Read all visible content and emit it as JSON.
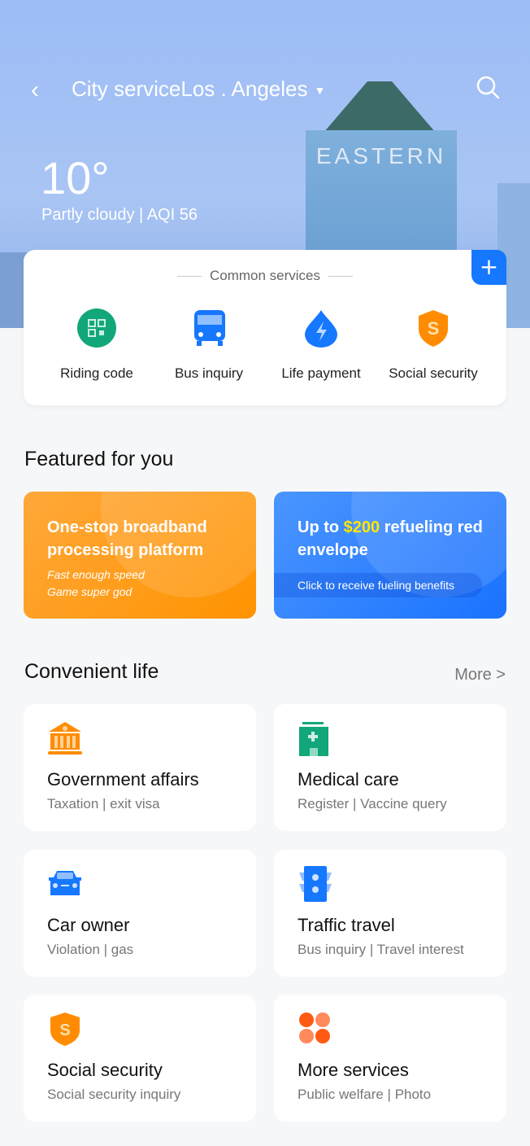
{
  "header": {
    "title": "City serviceLos . Angeles",
    "building_sign": "EASTERN"
  },
  "weather": {
    "temperature": "10°",
    "summary": "Partly cloudy | AQI 56"
  },
  "common_services": {
    "title": "Common services",
    "items": [
      {
        "label": "Riding code",
        "icon": "qr-code-icon",
        "color": "#12a77a"
      },
      {
        "label": "Bus inquiry",
        "icon": "bus-icon",
        "color": "#1677ff"
      },
      {
        "label": "Life payment",
        "icon": "bolt-drop-icon",
        "color": "#1677ff"
      },
      {
        "label": "Social security",
        "icon": "shield-s-icon",
        "color": "#ff8c00"
      }
    ]
  },
  "featured": {
    "title": "Featured for you",
    "banners": [
      {
        "title": "One-stop broadband processing platform",
        "lines": [
          "Fast enough speed",
          "Game super god"
        ],
        "color": "#ff9a10"
      },
      {
        "title_pre": "Up to ",
        "title_highlight": "$200",
        "title_post": " refueling red envelope",
        "action": "Click to receive fueling benefits",
        "color": "#2b82ff"
      }
    ]
  },
  "convenient": {
    "title": "Convenient life",
    "more": "More >",
    "items": [
      {
        "title": "Government affairs",
        "subtitle": "Taxation | exit visa",
        "icon": "government-building-icon"
      },
      {
        "title": "Medical care",
        "subtitle": "Register | Vaccine query",
        "icon": "hospital-icon"
      },
      {
        "title": "Car owner",
        "subtitle": "Violation | gas",
        "icon": "car-icon"
      },
      {
        "title": "Traffic travel",
        "subtitle": "Bus inquiry | Travel interest",
        "icon": "traffic-light-icon"
      },
      {
        "title": "Social security",
        "subtitle": "Social security inquiry",
        "icon": "shield-s-icon"
      },
      {
        "title": "More services",
        "subtitle": "Public welfare | Photo",
        "icon": "grid-dots-icon"
      }
    ]
  }
}
